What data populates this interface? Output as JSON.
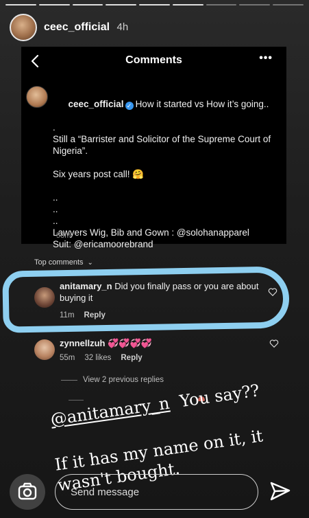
{
  "story": {
    "username": "ceec_official",
    "time": "4h"
  },
  "panel": {
    "title": "Comments",
    "more": "•••",
    "post": {
      "username": "ceec_official",
      "line1": "How it started vs How it’s going..",
      "line2": ".",
      "line3": "Still a “Barrister and Solicitor of the Supreme Court of Nigeria”.",
      "line4": "Six years post call! 🤗",
      "line5": "..",
      "line6": "..",
      "line7": "..",
      "line8": "Lawyers Wig, Bib and Gown : @solohanapparel",
      "line9": "Suit: @ericamoorebrand",
      "time": "58m"
    }
  },
  "comments": {
    "header": "Top comments",
    "items": [
      {
        "username": "anitamary_n",
        "text": "Did you finally pass or you are about buying it",
        "time": "11m",
        "likes": "",
        "reply": "Reply"
      },
      {
        "username": "zynnellzuh",
        "text": "💞💞💞💞",
        "time": "55m",
        "likes": "32 likes",
        "reply": "Reply"
      }
    ],
    "view_replies": "View 2 previous replies"
  },
  "overlay": {
    "mention": "@anitamary_n",
    "line1_rest": "You say??",
    "line2": "If it has my name on it, it wasn't bought."
  },
  "bottom": {
    "placeholder": "Send message"
  },
  "colors": {
    "highlight": "#8ecff0",
    "verified": "#3897f0"
  }
}
